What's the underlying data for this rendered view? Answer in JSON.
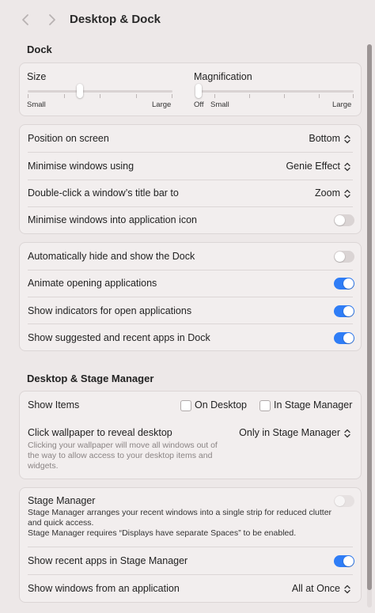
{
  "window": {
    "title": "Desktop & Dock"
  },
  "dock": {
    "heading": "Dock",
    "size": {
      "label": "Size",
      "min_label": "Small",
      "max_label": "Large",
      "level": 0.36
    },
    "magnification": {
      "label": "Magnification",
      "off_label": "Off",
      "min_label": "Small",
      "max_label": "Large",
      "level": 0.0
    },
    "position": {
      "label": "Position on screen",
      "value": "Bottom"
    },
    "minimise_using": {
      "label": "Minimise windows using",
      "value": "Genie Effect"
    },
    "double_click": {
      "label": "Double-click a window’s title bar to",
      "value": "Zoom"
    },
    "minimise_into_icon": {
      "label": "Minimise windows into application icon",
      "on": false
    },
    "autohide": {
      "label": "Automatically hide and show the Dock",
      "on": false
    },
    "animate": {
      "label": "Animate opening applications",
      "on": true
    },
    "indicators": {
      "label": "Show indicators for open applications",
      "on": true
    },
    "suggested": {
      "label": "Show suggested and recent apps in Dock",
      "on": true
    }
  },
  "stage": {
    "heading": "Desktop & Stage Manager",
    "show_items": {
      "label": "Show Items",
      "on_desktop": "On Desktop",
      "in_stage_manager": "In Stage Manager"
    },
    "click_wallpaper": {
      "label": "Click wallpaper to reveal desktop",
      "value": "Only in Stage Manager",
      "description": "Clicking your wallpaper will move all windows out of the way to allow access to your desktop items and widgets."
    },
    "stage_manager": {
      "label": "Stage Manager",
      "description_1": "Stage Manager arranges your recent windows into a single strip for reduced clutter and quick access.",
      "description_2": "Stage Manager requires “Displays have separate Spaces” to be enabled.",
      "on": false
    },
    "recent_apps": {
      "label": "Show recent apps in Stage Manager",
      "on": true
    },
    "show_windows": {
      "label": "Show windows from an application",
      "value": "All at Once"
    }
  },
  "colors": {
    "accent": "#2f7df6",
    "background": "#ede8e8",
    "card": "#f2eeee"
  },
  "icons": {
    "back": "chevron-left-icon",
    "forward": "chevron-right-icon",
    "popup": "up-down-chevron-icon"
  }
}
